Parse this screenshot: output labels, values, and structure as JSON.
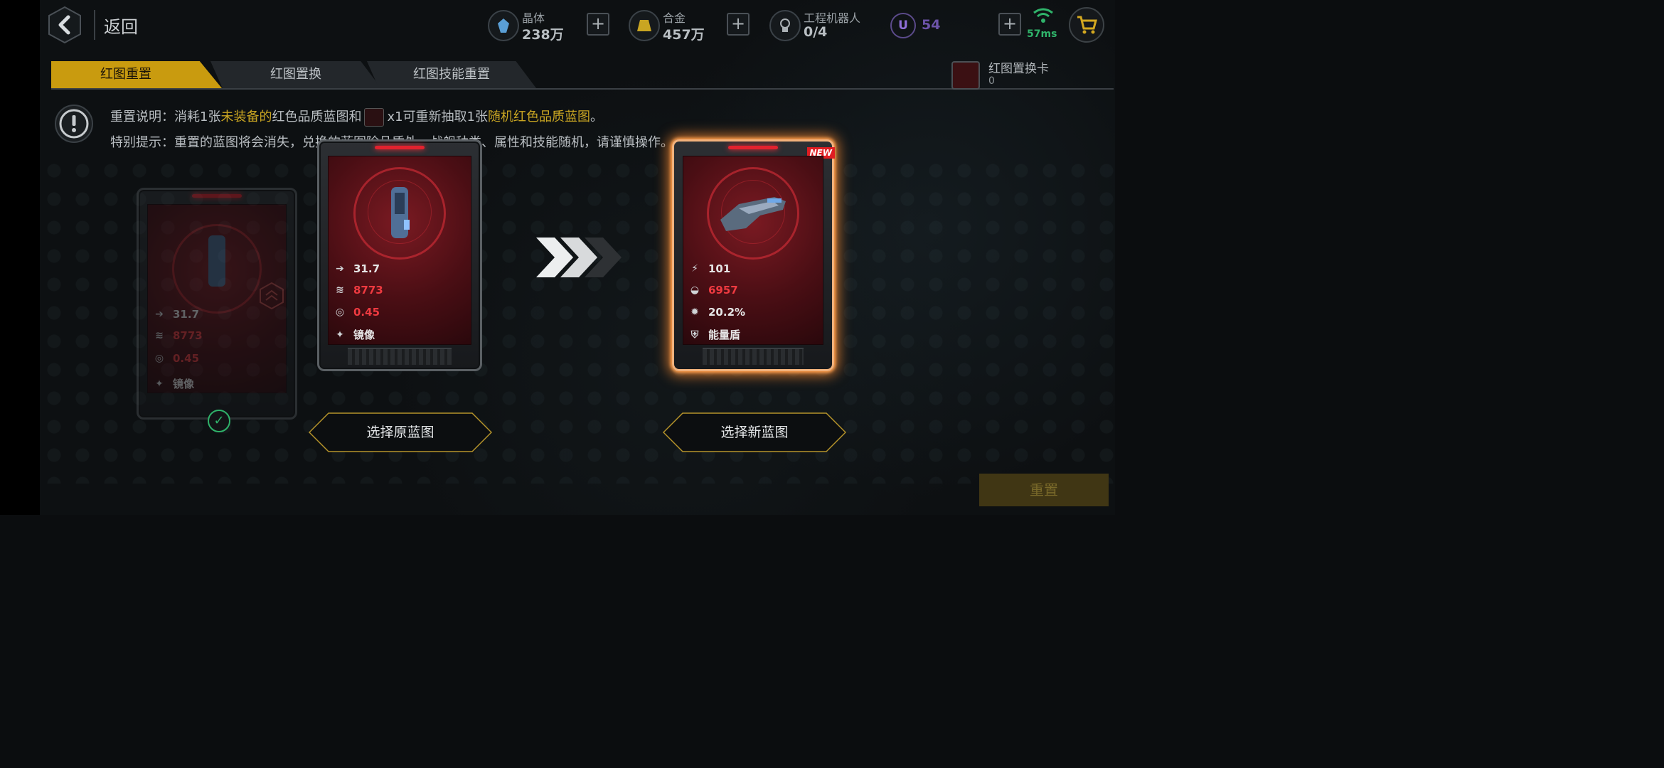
{
  "header": {
    "back_label": "返回",
    "resources": [
      {
        "name": "晶体",
        "value": "238万",
        "icon": "crystal-icon"
      },
      {
        "name": "合金",
        "value": "457万",
        "icon": "alloy-icon"
      },
      {
        "name": "工程机器人",
        "value": "0/4",
        "icon": "robot-icon"
      }
    ],
    "u_badge": "U",
    "u_value": "54",
    "ping": "57ms"
  },
  "tabs": [
    {
      "label": "红图重置",
      "active": true
    },
    {
      "label": "红图置换",
      "active": false
    },
    {
      "label": "红图技能重置",
      "active": false
    }
  ],
  "reset_card": {
    "name": "红图置换卡",
    "count": "0"
  },
  "info": {
    "line1_a": "重置说明：消耗1张",
    "line1_b": "未装备的",
    "line1_c": "红色品质蓝图和",
    "line1_d": "x1可重新抽取1张",
    "line1_e": "随机红色品质蓝图",
    "line1_f": "。",
    "line2": "特别提示：重置的蓝图将会消失，兑换的蓝图除品质外，战舰种类、属性和技能随机，请谨慎操作。"
  },
  "cards": {
    "original_stats": {
      "speed": "31.7",
      "hp": "8773",
      "rate": "0.45",
      "skill": "镜像"
    },
    "new_stats": {
      "attack": "101",
      "hp": "6957",
      "crit": "20.2%",
      "skill": "能量盾"
    },
    "new_badge": "NEW"
  },
  "buttons": {
    "select_original": "选择原蓝图",
    "select_new": "选择新蓝图",
    "reset": "重置"
  },
  "colors": {
    "accent": "#c99b0f",
    "red": "#ee3a40",
    "green": "#2fb36a"
  }
}
